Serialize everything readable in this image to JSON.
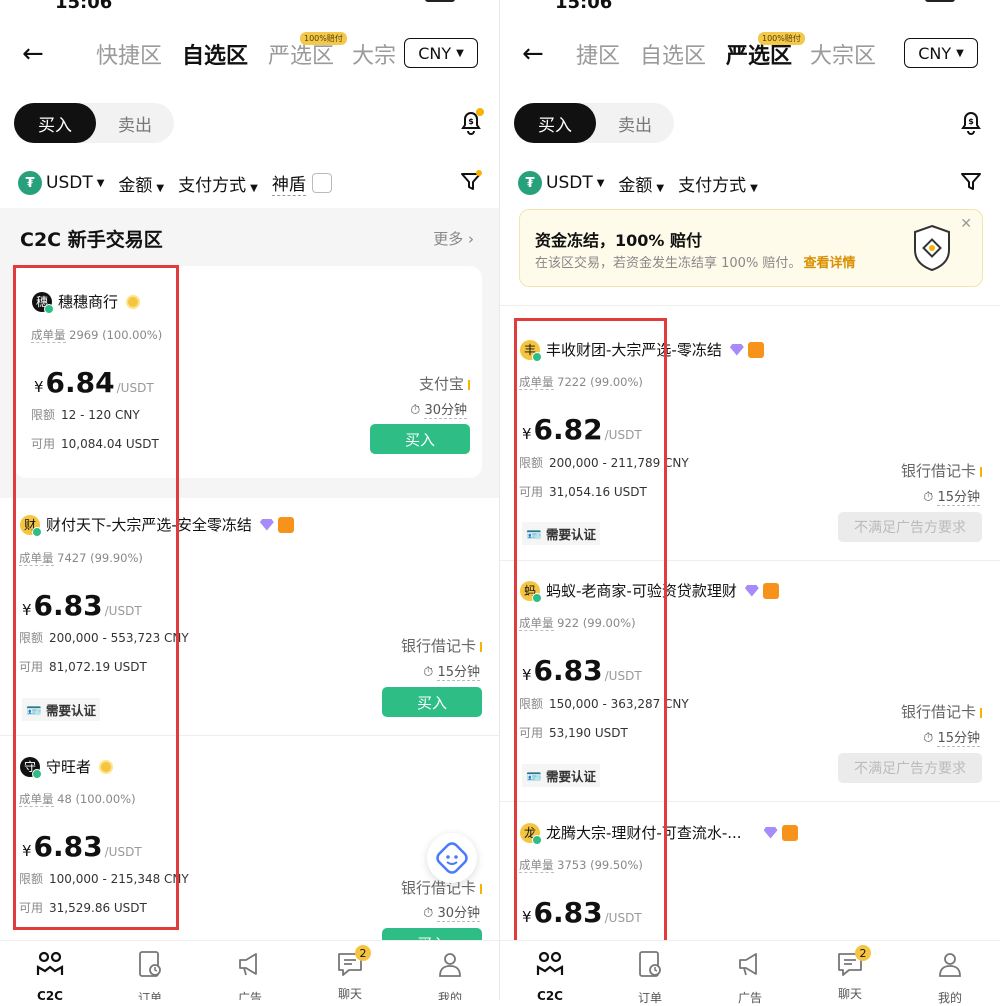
{
  "left": {
    "status_time": "15:06",
    "tabs": [
      "快捷区",
      "自选区",
      "严选区",
      "大宗"
    ],
    "active_tab": 1,
    "promo_tag": "100%赔付",
    "currency": "CNY",
    "side_tabs": {
      "buy": "买入",
      "sell": "卖出"
    },
    "filters": {
      "coin": "USDT",
      "amount": "金额",
      "payment": "支付方式",
      "shield": "神盾"
    },
    "section": {
      "title": "C2C 新手交易区",
      "more": "更多 ›"
    },
    "ads": [
      {
        "avatar": "穗",
        "avatar_color": "#111111",
        "name": "穗穗商行",
        "badge": "gold",
        "orders_label": "成单量",
        "orders": "2969 (100.00%)",
        "yen": "¥",
        "price": "6.84",
        "unit": "/USDT",
        "limit_label": "限额",
        "limit": "12 - 120 CNY",
        "avail_label": "可用",
        "avail": "10,084.04 USDT",
        "payment": "支付宝",
        "duration": "30分钟",
        "action": "买入"
      },
      {
        "avatar": "财",
        "avatar_color": "#f5c542",
        "name": "财付天下-大宗严选-安全零冻结",
        "badge": "purple-orange",
        "orders_label": "成单量",
        "orders": "7427 (99.90%)",
        "yen": "¥",
        "price": "6.83",
        "unit": "/USDT",
        "limit_label": "限额",
        "limit": "200,000 - 553,723 CNY",
        "avail_label": "可用",
        "avail": "81,072.19 USDT",
        "payment": "银行借记卡",
        "duration": "15分钟",
        "action": "买入",
        "verify": "需要认证"
      },
      {
        "avatar": "守",
        "avatar_color": "#111111",
        "name": "守旺者",
        "badge": "gold",
        "orders_label": "成单量",
        "orders": "48 (100.00%)",
        "yen": "¥",
        "price": "6.83",
        "unit": "/USDT",
        "limit_label": "限额",
        "limit": "100,000 - 215,348 CNY",
        "avail_label": "可用",
        "avail": "31,529.86 USDT",
        "payment": "银行借记卡",
        "duration": "30分钟",
        "action": "买入"
      }
    ]
  },
  "right": {
    "status_time": "15:06",
    "tabs": [
      "捷区",
      "自选区",
      "严选区",
      "大宗区"
    ],
    "active_tab": 2,
    "promo_tag": "100%赔付",
    "currency": "CNY",
    "side_tabs": {
      "buy": "买入",
      "sell": "卖出"
    },
    "filters": {
      "coin": "USDT",
      "amount": "金额",
      "payment": "支付方式"
    },
    "banner": {
      "title": "资金冻结，100% 赔付",
      "desc": "在该区交易，若资金发生冻结享 100% 赔付。",
      "link": "查看详情"
    },
    "ads": [
      {
        "avatar": "丰",
        "avatar_color": "#f5c542",
        "name": "丰收财团-大宗严选-零冻结",
        "orders_label": "成单量",
        "orders": "7222 (99.00%)",
        "yen": "¥",
        "price": "6.82",
        "unit": "/USDT",
        "limit_label": "限额",
        "limit": "200,000 - 211,789 CNY",
        "avail_label": "可用",
        "avail": "31,054.16 USDT",
        "payment": "银行借记卡",
        "duration": "15分钟",
        "action": "不满足广告方要求",
        "verify": "需要认证"
      },
      {
        "avatar": "蚂",
        "avatar_color": "#f5c542",
        "name": "蚂蚁-老商家-可验资贷款理财",
        "orders_label": "成单量",
        "orders": "922 (99.00%)",
        "yen": "¥",
        "price": "6.83",
        "unit": "/USDT",
        "limit_label": "限额",
        "limit": "150,000 - 363,287 CNY",
        "avail_label": "可用",
        "avail": "53,190 USDT",
        "payment": "银行借记卡",
        "duration": "15分钟",
        "action": "不满足广告方要求",
        "verify": "需要认证"
      },
      {
        "avatar": "龙",
        "avatar_color": "#f5c542",
        "name": "龙腾大宗-理财付-可查流水-...",
        "orders_label": "成单量",
        "orders": "3753 (99.50%)",
        "yen": "¥",
        "price": "6.83",
        "unit": "/USDT"
      }
    ]
  },
  "nav": [
    {
      "label": "C2C",
      "icon": "c2c-icon"
    },
    {
      "label": "订单",
      "icon": "orders-icon"
    },
    {
      "label": "广告",
      "icon": "megaphone-icon"
    },
    {
      "label": "聊天",
      "icon": "chat-icon",
      "badge": "2"
    },
    {
      "label": "我的",
      "icon": "profile-icon"
    }
  ],
  "colors": {
    "accent": "#2ebd85",
    "highlight": "#e03c3c",
    "gold": "#f5c542"
  }
}
